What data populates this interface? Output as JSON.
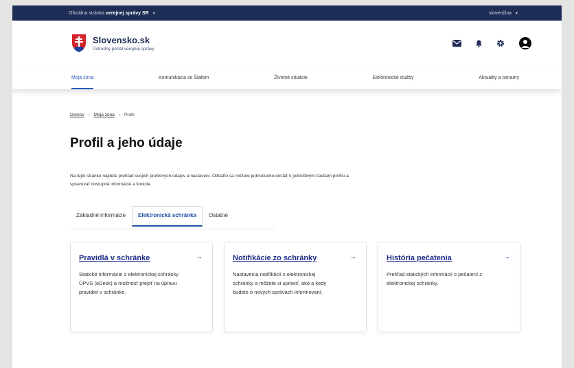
{
  "govbar": {
    "official_prefix": "Oficiálna stránka",
    "official_bold": "verejnej správy SR",
    "caret": "▾",
    "language": "slovenčina",
    "language_caret": "▾"
  },
  "header": {
    "brand_title": "Slovensko.sk",
    "brand_subtitle": "Ústredný portál verejnej správy",
    "icons": [
      "mail-icon",
      "bell-icon",
      "gear-icon",
      "user-avatar-icon"
    ],
    "brand_colors": {
      "navy": "#1e2d55",
      "red": "#d2232a",
      "accent": "#2a5bb8"
    }
  },
  "nav": {
    "items": [
      {
        "label": "Moja zóna",
        "active": true
      },
      {
        "label": "Komunikácia so Štátom"
      },
      {
        "label": "Životné situácie"
      },
      {
        "label": "Elektronické služby"
      },
      {
        "label": "Aktuality a oznamy"
      }
    ]
  },
  "breadcrumb": {
    "items": [
      "Domov",
      "Moja zóna",
      "Profil"
    ],
    "separator": "›"
  },
  "page": {
    "title": "Profil a jeho údaje",
    "intro": "Na tejto stránke nájdete prehľad svojich profilových údajov a nastavení. Odtiaľto sa môžete jednoducho dostať k jednotlivým častiam profilu a spravovať dostupné informácie a funkcie."
  },
  "tabs": [
    {
      "label": "Základné informácie"
    },
    {
      "label": "Elektronická schránka",
      "active": true
    },
    {
      "label": "Ostatné"
    }
  ],
  "cards": [
    {
      "title": "Pravidlá v schránke",
      "arrow": "→",
      "desc": "Statické informácie z elektronickej schránky ÚPVS (eDesk) a možnosť prejsť na úpravu pravidiel v schránke."
    },
    {
      "title": "Notifikácie zo schránky",
      "arrow": "→",
      "desc": "Nastavenia notifikácií z elektronickej schránky a môžete si upraviť, ako a kedy budete o nových správach informovaní."
    },
    {
      "title": "História pečatenia",
      "arrow": "→",
      "desc": "Prehľad statických informácií o pečatení z elektronickej schránky."
    }
  ]
}
